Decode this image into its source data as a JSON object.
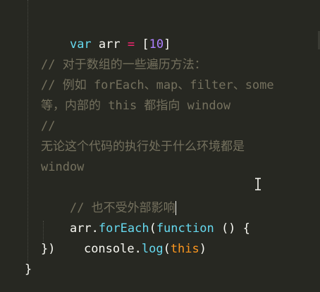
{
  "editor": {
    "lines": {
      "l1": {
        "kw": "var",
        "name": " arr ",
        "op": "=",
        "sp": " ",
        "open": "[",
        "num": "10",
        "close": "]"
      },
      "l2": {
        "comment": "// 对于数组的一些遍历方法："
      },
      "l3": {
        "comment": "// 例如 forEach、map、filter、some"
      },
      "l4": {
        "comment": "等，内部的 this 都指向 window"
      },
      "l5": {
        "comment": "//"
      },
      "l6": {
        "comment": "无论这个代码的执行处于什么环境都是"
      },
      "l7": {
        "comment": "window"
      },
      "l8": {
        "comment": "// 也不受外部影响"
      },
      "l9": {
        "obj": "arr.",
        "method": "forEach",
        "paren": "(",
        "kw": "function",
        "rest": " () {"
      },
      "l10": {
        "obj": "console.",
        "method": "log",
        "open": "(",
        "this": "this",
        "close": ")"
      },
      "l11": {
        "text": "})"
      },
      "l12": {
        "text": "}"
      }
    }
  }
}
